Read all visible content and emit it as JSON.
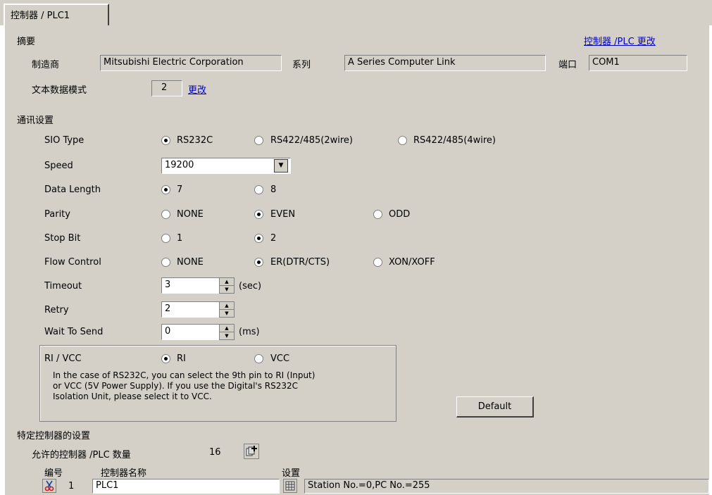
{
  "tab": {
    "label": "控制器 / PLC1"
  },
  "summary": {
    "heading": "摘要",
    "change_link": "控制器 /PLC 更改",
    "maker_label": "制造商",
    "maker_value": "Mitsubishi Electric Corporation",
    "series_label": "系列",
    "series_value": "A Series Computer Link",
    "port_label": "端口",
    "port_value": "COM1",
    "text_mode_label": "文本数据模式",
    "text_mode_value": "2",
    "text_mode_change": "更改"
  },
  "comm": {
    "heading": "通讯设置",
    "sio_type": {
      "label": "SIO Type",
      "options": [
        "RS232C",
        "RS422/485(2wire)",
        "RS422/485(4wire)"
      ],
      "selected": 0
    },
    "speed": {
      "label": "Speed",
      "value": "19200"
    },
    "data_length": {
      "label": "Data Length",
      "options": [
        "7",
        "8"
      ],
      "selected": 0
    },
    "parity": {
      "label": "Parity",
      "options": [
        "NONE",
        "EVEN",
        "ODD"
      ],
      "selected": 1
    },
    "stop_bit": {
      "label": "Stop Bit",
      "options": [
        "1",
        "2"
      ],
      "selected": 1
    },
    "flow_control": {
      "label": "Flow Control",
      "options": [
        "NONE",
        "ER(DTR/CTS)",
        "XON/XOFF"
      ],
      "selected": 1
    },
    "timeout": {
      "label": "Timeout",
      "value": "3",
      "unit": "(sec)"
    },
    "retry": {
      "label": "Retry",
      "value": "2"
    },
    "wait_to_send": {
      "label": "Wait To Send",
      "value": "0",
      "unit": "(ms)"
    },
    "ri_vcc": {
      "label": "RI / VCC",
      "options": [
        "RI",
        "VCC"
      ],
      "selected": 0,
      "note_lines": [
        "In the case of RS232C, you can select the 9th pin to RI (Input)",
        "or VCC (5V Power Supply). If you use the Digital's RS232C",
        "Isolation Unit, please select it to VCC."
      ]
    },
    "default_button": "Default"
  },
  "device": {
    "heading": "特定控制器的设置",
    "allowed_label": "允许的控制器 /PLC 数量",
    "allowed_value": "16",
    "col_no": "编号",
    "col_name": "控制器名称",
    "col_settings": "设置",
    "rows": [
      {
        "no": "1",
        "name": "PLC1",
        "settings": "Station No.=0,PC No.=255"
      }
    ]
  },
  "colors": {
    "panel": "#d4d0c8",
    "link": "#0000cc"
  },
  "icons": [
    "add-device-icon",
    "cut-icon",
    "settings-icon",
    "dropdown-arrow-icon",
    "spin-up-icon",
    "spin-down-icon"
  ]
}
